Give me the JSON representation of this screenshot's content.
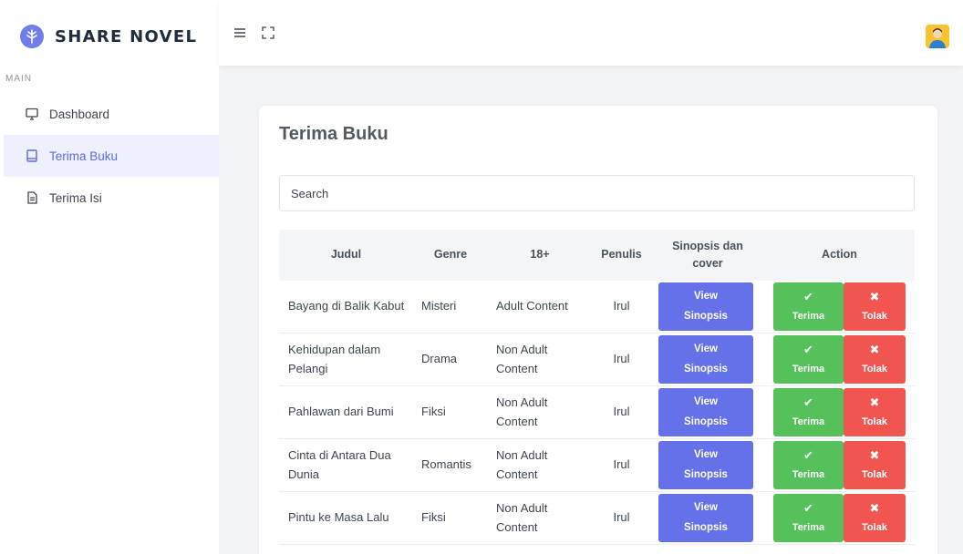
{
  "brand": {
    "name": "SHARE NOVEL",
    "accent": "#6f7ee8"
  },
  "sidebar": {
    "section_label": "MAIN",
    "items": [
      {
        "label": "Dashboard",
        "icon": "monitor-icon",
        "active": false
      },
      {
        "label": "Terima Buku",
        "icon": "book-icon",
        "active": true
      },
      {
        "label": "Terima Isi",
        "icon": "file-text-icon",
        "active": false
      }
    ]
  },
  "topbar": {
    "menu_icon": "hamburger-icon",
    "fullscreen_icon": "fullscreen-icon",
    "avatar_icon": "user-avatar-icon"
  },
  "page": {
    "title": "Terima Buku",
    "search": {
      "placeholder": "Search",
      "value": ""
    }
  },
  "table": {
    "headers": {
      "judul": "Judul",
      "genre": "Genre",
      "adult": "18+",
      "penulis": "Penulis",
      "sinopsis": "Sinopsis dan cover",
      "action": "Action"
    },
    "view_label_1": "View",
    "view_label_2": "Sinopsis",
    "accept_label": "Terima",
    "reject_label": "Tolak",
    "accept_glyph": "✔",
    "reject_glyph": "✖",
    "rows": [
      {
        "judul": "Bayang di Balik Kabut",
        "genre": "Misteri",
        "adult": "Adult Content",
        "penulis": "Irul"
      },
      {
        "judul": "Kehidupan dalam Pelangi",
        "genre": "Drama",
        "adult": "Non Adult Content",
        "penulis": "Irul"
      },
      {
        "judul": "Pahlawan dari Bumi",
        "genre": "Fiksi",
        "adult": "Non Adult Content",
        "penulis": "Irul"
      },
      {
        "judul": "Cinta di Antara Dua Dunia",
        "genre": "Romantis",
        "adult": "Non Adult Content",
        "penulis": "Irul"
      },
      {
        "judul": "Pintu ke Masa Lalu",
        "genre": "Fiksi",
        "adult": "Non Adult Content",
        "penulis": "Irul"
      }
    ]
  },
  "colors": {
    "primary": "#6471e9",
    "success": "#55c15a",
    "danger": "#f25550"
  }
}
